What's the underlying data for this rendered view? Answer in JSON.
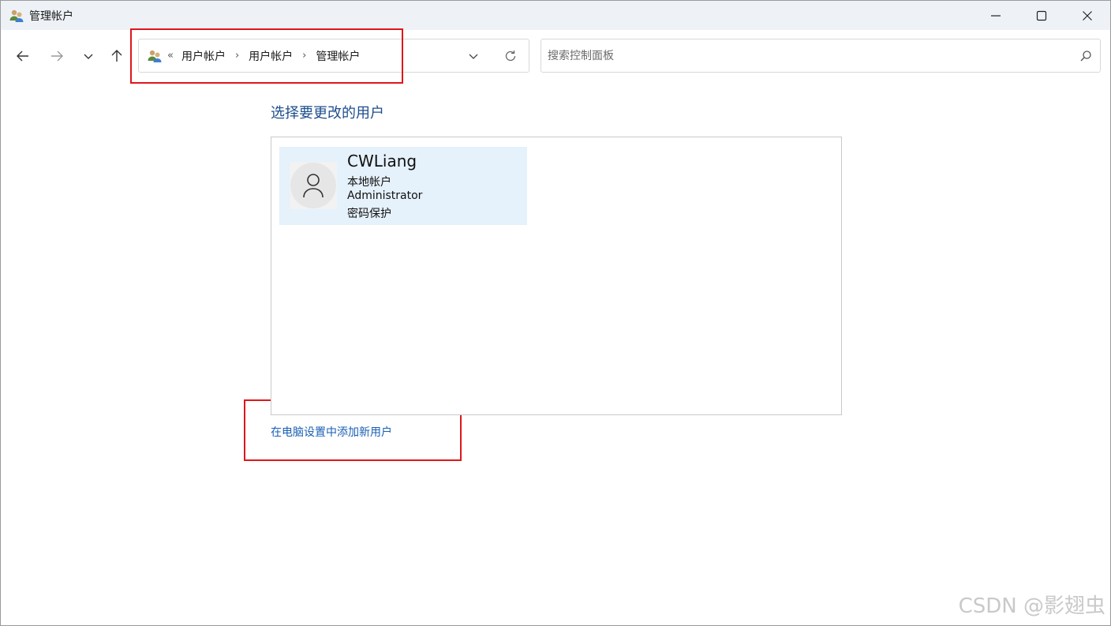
{
  "window": {
    "title": "管理帐户"
  },
  "nav": {
    "breadcrumb_overflow": "«",
    "breadcrumbs": [
      "用户帐户",
      "用户帐户",
      "管理帐户"
    ],
    "separator": "›"
  },
  "search": {
    "placeholder": "搜索控制面板"
  },
  "main": {
    "heading": "选择要更改的用户",
    "users": [
      {
        "name": "CWLiang",
        "account_type": "本地帐户",
        "role": "Administrator",
        "protection": "密码保护"
      }
    ],
    "add_user_link": "在电脑设置中添加新用户"
  },
  "watermark": "CSDN @影翅虫",
  "colors": {
    "titlebar_bg": "#eef2f7",
    "heading": "#1e4e8c",
    "link": "#1a5fb4",
    "tile_selected": "#e5f1fb",
    "highlight_box": "#e0161b"
  }
}
